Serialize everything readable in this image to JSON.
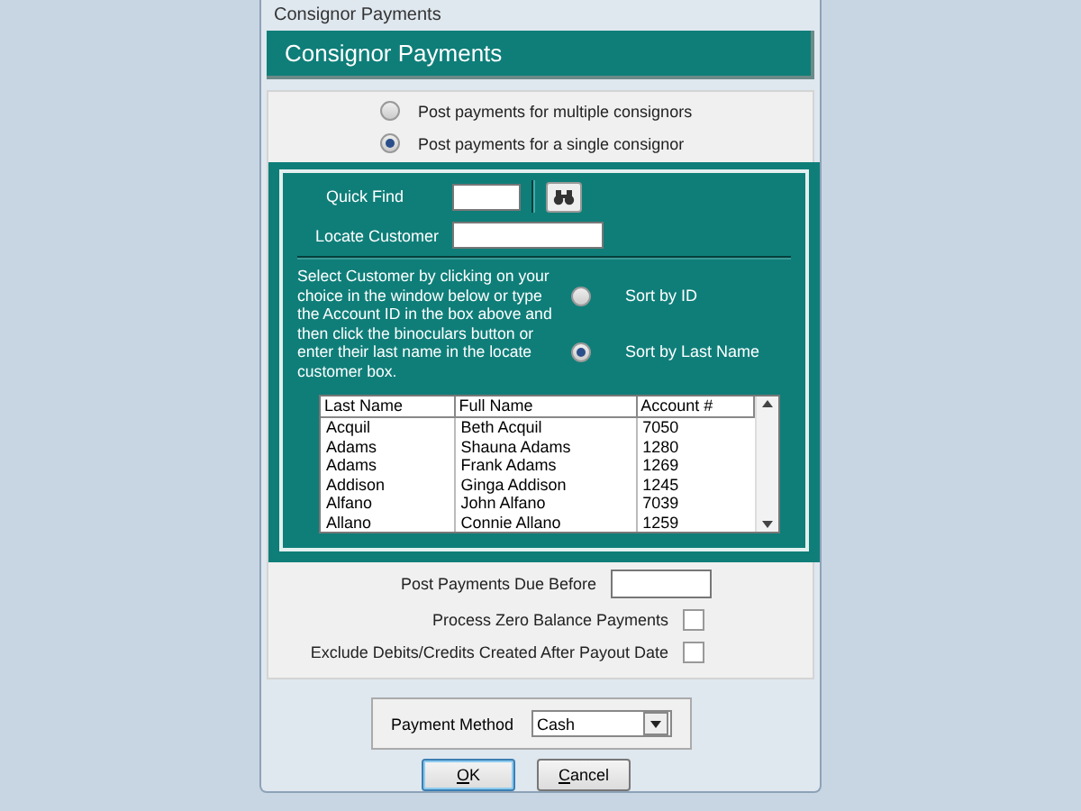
{
  "window": {
    "title": "Consignor Payments"
  },
  "header": {
    "title": "Consignor Payments"
  },
  "mode_options": [
    {
      "label": "Post payments for multiple consignors",
      "selected": false
    },
    {
      "label": "Post payments for a single consignor",
      "selected": true
    }
  ],
  "quick_find": {
    "label": "Quick Find"
  },
  "locate_customer": {
    "label": "Locate Customer"
  },
  "instructions": "Select Customer by clicking on your choice in the window below or type the Account ID in the box above and then click the binoculars button or enter their last name in the locate customer box.",
  "sort_options": [
    {
      "label": "Sort by ID",
      "selected": false
    },
    {
      "label": "Sort by Last Name",
      "selected": true
    }
  ],
  "customer_list": {
    "columns": [
      "Last Name",
      "Full Name",
      "Account #"
    ],
    "rows": [
      [
        "Acquil",
        "Beth Acquil",
        "7050"
      ],
      [
        "Adams",
        "Shauna Adams",
        "1280"
      ],
      [
        "Adams",
        "Frank Adams",
        "1269"
      ],
      [
        "Addison",
        "Ginga Addison",
        "1245"
      ],
      [
        "Alfano",
        "John Alfano",
        "7039"
      ],
      [
        "Allano",
        "Connie Allano",
        "1259"
      ]
    ]
  },
  "due_before": {
    "label": "Post Payments Due Before"
  },
  "options": [
    {
      "label": "Process Zero Balance Payments",
      "checked": false
    },
    {
      "label": "Exclude Debits/Credits Created After Payout Date",
      "checked": false
    }
  ],
  "payment_method": {
    "label": "Payment Method",
    "value": "Cash"
  },
  "buttons": [
    {
      "label": "OK",
      "default": true
    },
    {
      "label": "Cancel",
      "default": false
    }
  ]
}
